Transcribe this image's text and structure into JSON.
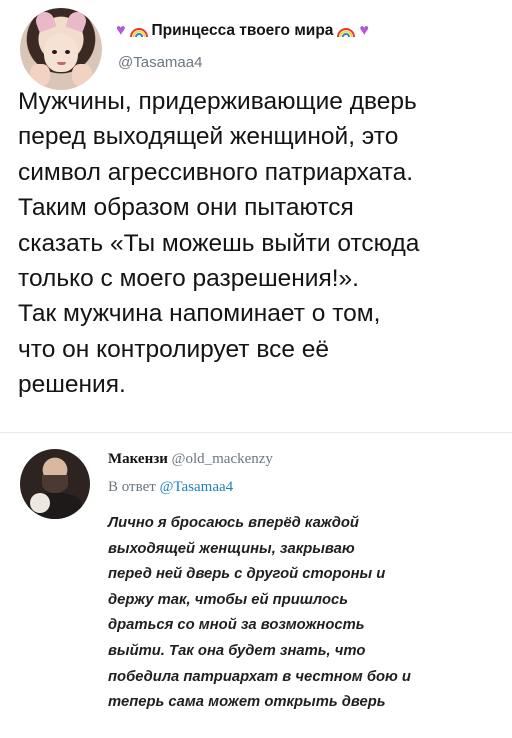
{
  "tweet1": {
    "display_name": "Принцесса твоего мира",
    "handle": "@Tasamaa4",
    "emoji_left": "purple-heart-and-rainbow",
    "emoji_right": "rainbow-and-purple-heart",
    "body": "Мужчины, придерживающие дверь\nперед выходящей женщиной, это\nсимвол агрессивного патриархата.\nТаким образом они пытаются\nсказать «Ты можешь выйти отсюда\nтолько с моего разрешения!».\nТак мужчина напоминает о том,\nчто он контролирует все её\nрешения."
  },
  "tweet2": {
    "display_name": "Макензи",
    "handle": "@old_mackenzy",
    "reply_prefix": "В ответ",
    "reply_handle": "@Tasamaa4",
    "body": "Лично я бросаюсь вперёд каждой\nвыходящей женщины, закрываю\nперед ней дверь с другой стороны и\nдержу так, чтобы ей пришлось\nдраться со мной за возможность\nвыйти. Так она будет знать, что\nпобедила патриархат в честном бою и\nтеперь сама может открыть дверь"
  },
  "colors": {
    "heart": "#b05bd6",
    "handle_gray": "#6c7680",
    "link_blue": "#1d7fc4"
  }
}
